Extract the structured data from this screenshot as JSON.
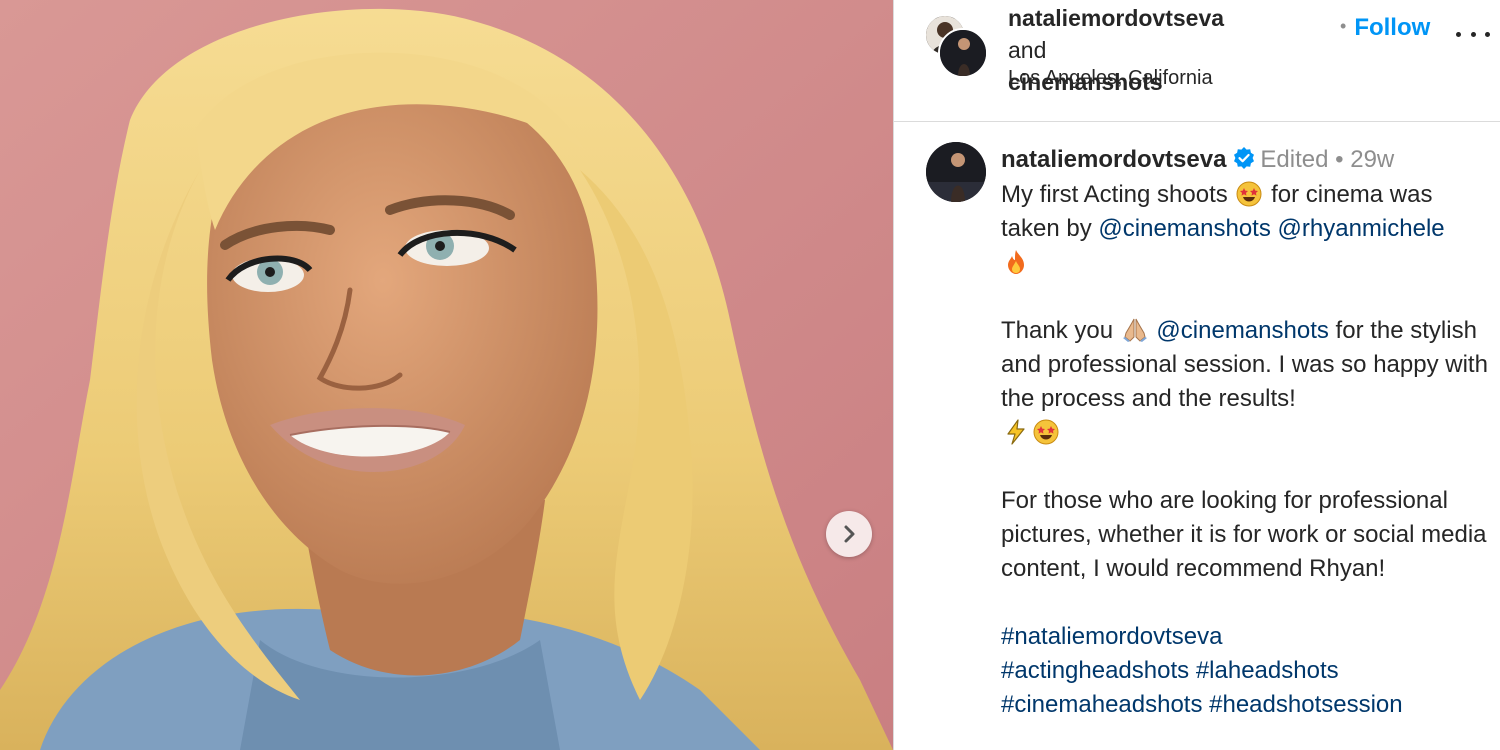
{
  "post": {
    "image": {
      "alt_semantic": "portrait-photo",
      "background_color": "#cf8a8a"
    },
    "carousel_next_icon": "chevron-right-icon"
  },
  "header": {
    "author_primary": "nataliemordovtseva",
    "author_joiner": "and",
    "author_secondary": "cinemanshots",
    "location": "Los Angeles, California",
    "follow_label": "Follow",
    "follow_separator": "•",
    "more_icon": "more-options-icon"
  },
  "caption": {
    "username": "nataliemordovtseva",
    "verified_icon": "verified-badge-icon",
    "edited_label": "Edited",
    "separator": "•",
    "time_ago": "29w",
    "line1_a": "My first Acting shoots",
    "line1_b": "for cinema was taken by",
    "mention_1": "@cinemanshots",
    "mention_2": "@rhyanmichele",
    "para2_a": "Thank you",
    "mention_3": "@cinemanshots",
    "para2_b": "for the stylish and professional session. I was so happy with the process and the results!",
    "para3": "For those who are looking for professional pictures, whether it is for work or social media content, I would recommend Rhyan!",
    "hashtags": [
      "#nataliemordovtseva",
      "#actingheadshots",
      "#laheadshots",
      "#cinemaheadshots",
      "#headshotsession"
    ],
    "emojis": {
      "star_struck": "star-struck-emoji",
      "fire": "fire-emoji",
      "folded_hands": "folded-hands-emoji",
      "lightning": "high-voltage-emoji"
    }
  },
  "colors": {
    "link": "#00376b",
    "follow": "#0095f6",
    "muted": "#8e8e8e",
    "verified": "#0095f6",
    "photo_background": "#cf8a8a",
    "hair": "#f0cf7a",
    "sweater": "#7f9fc0"
  }
}
